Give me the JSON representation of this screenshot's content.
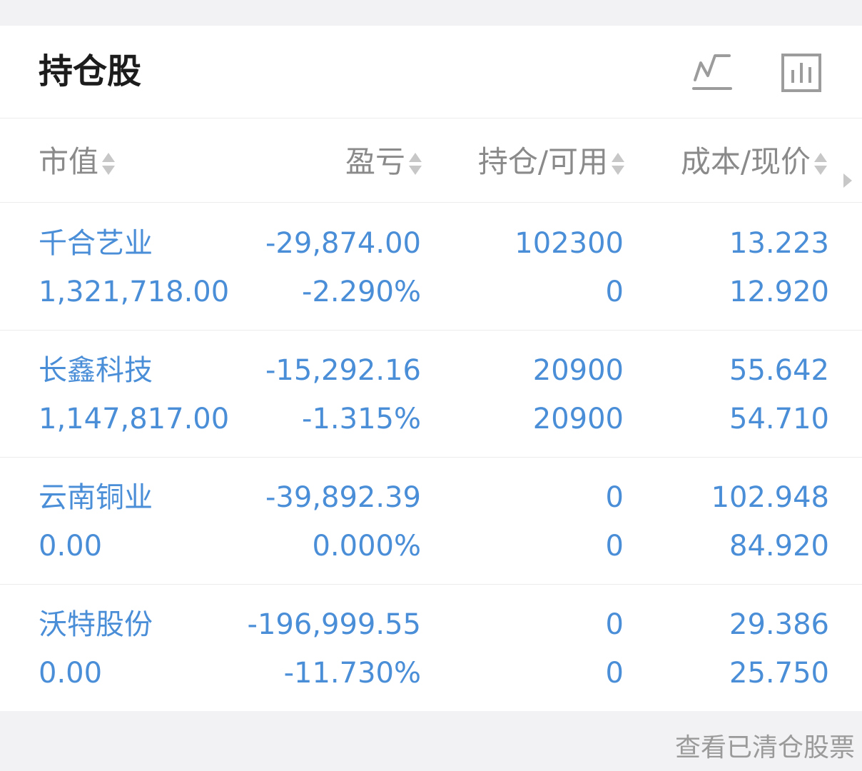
{
  "header": {
    "title": "持仓股",
    "icons": [
      "line-chart-icon",
      "bar-chart-icon"
    ]
  },
  "columns": [
    {
      "label": "市值"
    },
    {
      "label": "盈亏"
    },
    {
      "label": "持仓/可用"
    },
    {
      "label": "成本/现价"
    }
  ],
  "rows": [
    {
      "name": "千合艺业",
      "market_value": "1,321,718.00",
      "pl": "-29,874.00",
      "pl_pct": "-2.290%",
      "position": "102300",
      "available": "0",
      "cost": "13.223",
      "price": "12.920"
    },
    {
      "name": "长鑫科技",
      "market_value": "1,147,817.00",
      "pl": "-15,292.16",
      "pl_pct": "-1.315%",
      "position": "20900",
      "available": "20900",
      "cost": "55.642",
      "price": "54.710"
    },
    {
      "name": "云南铜业",
      "market_value": "0.00",
      "pl": "-39,892.39",
      "pl_pct": "0.000%",
      "position": "0",
      "available": "0",
      "cost": "102.948",
      "price": "84.920"
    },
    {
      "name": "沃特股份",
      "market_value": "0.00",
      "pl": "-196,999.55",
      "pl_pct": "-11.730%",
      "position": "0",
      "available": "0",
      "cost": "29.386",
      "price": "25.750"
    }
  ],
  "footer": {
    "link": "查看已清仓股票"
  },
  "colors": {
    "accent": "#4a8ed8",
    "muted": "#8a8a8a",
    "title": "#1c1c1c"
  }
}
